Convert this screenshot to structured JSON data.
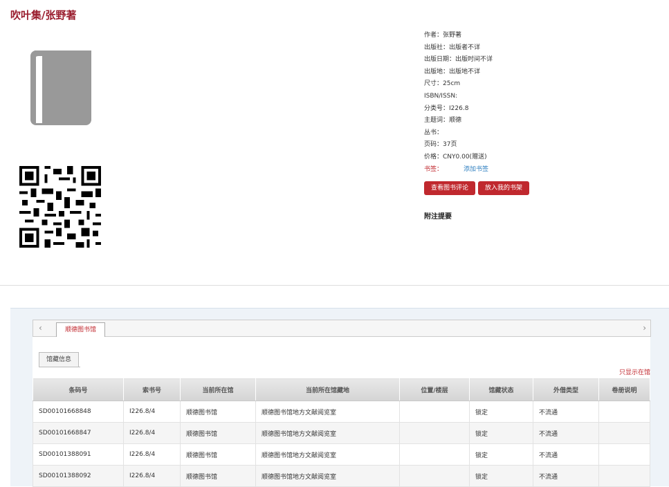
{
  "book": {
    "title": "吹叶集/张野著"
  },
  "meta": {
    "author": "作者：张野著",
    "publisher": "出版社：出版者不详",
    "pub_date": "出版日期：出版时间不详",
    "pub_place": "出版地：出版地不详",
    "size": "尺寸：25cm",
    "isbn": "ISBN/ISSN:",
    "class_no": "分类号：I226.8",
    "subject": "主题词：顺德",
    "series": "丛书：",
    "pages": "页码：37页",
    "price": "价格：CNY0.00(赠送)",
    "bookmark_label": "书签：",
    "bookmark_link": "添加书签"
  },
  "buttons": {
    "reviews": "查看图书评论",
    "shelf": "放入我的书架"
  },
  "notes_title": "附注提要",
  "holdings": {
    "nav_left": "‹",
    "nav_right": "›",
    "library_tab": "顺德图书馆",
    "sub_tab": "馆藏信息",
    "only_this": "只显示在馆",
    "columns": [
      "条码号",
      "索书号",
      "当前所在馆",
      "当前所在馆藏地",
      "位置/楼层",
      "馆藏状态",
      "外借类型",
      "卷册说明"
    ],
    "rows": [
      [
        "SD00101668848",
        "I226.8/4",
        "顺德图书馆",
        "顺德图书馆地方文献阅览室",
        "",
        "锁定",
        "不流通",
        ""
      ],
      [
        "SD00101668847",
        "I226.8/4",
        "顺德图书馆",
        "顺德图书馆地方文献阅览室",
        "",
        "锁定",
        "不流通",
        ""
      ],
      [
        "SD00101388091",
        "I226.8/4",
        "顺德图书馆",
        "顺德图书馆地方文献阅览室",
        "",
        "锁定",
        "不流通",
        ""
      ],
      [
        "SD00101388092",
        "I226.8/4",
        "顺德图书馆",
        "顺德图书馆地方文献阅览室",
        "",
        "锁定",
        "不流通",
        ""
      ]
    ]
  }
}
